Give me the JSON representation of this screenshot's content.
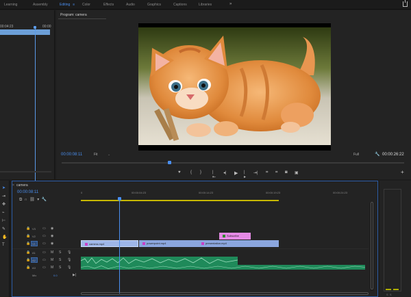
{
  "workspaces": [
    {
      "label": "Learning",
      "active": false
    },
    {
      "label": "Assembly",
      "active": false
    },
    {
      "label": "Editing",
      "active": true
    },
    {
      "label": "Color",
      "active": false
    },
    {
      "label": "Effects",
      "active": false
    },
    {
      "label": "Audio",
      "active": false
    },
    {
      "label": "Graphics",
      "active": false
    },
    {
      "label": "Captions",
      "active": false
    },
    {
      "label": "Libraries",
      "active": false
    }
  ],
  "workspace_menu_glyph": "≡",
  "workspace_more_glyph": "»",
  "source": {
    "timecode_left": "00:04:23",
    "timecode_right": "00:00"
  },
  "program": {
    "tab_label": "Program: camera",
    "tab_menu": "≡",
    "current_timecode": "00:00:08:11",
    "fit": "Fit",
    "resolution": "Full",
    "duration": "00:00:26:22",
    "add_glyph": "+"
  },
  "timeline": {
    "tab_label": "camera",
    "tab_menu": "≡",
    "close_glyph": "×",
    "current_timecode": "00:00:08:11",
    "ruler": [
      "0",
      "00:00:04:23",
      "00:00:14:23",
      "00:00:19:23",
      "00:00:24:23"
    ],
    "video_tracks": [
      {
        "name": "V3"
      },
      {
        "name": "V2"
      },
      {
        "name": "V1"
      }
    ],
    "audio_tracks": [
      {
        "name": "A1"
      },
      {
        "name": "A2"
      },
      {
        "name": "A3"
      }
    ],
    "mix": {
      "name": "Mix",
      "value": "0.0"
    },
    "clips": [
      {
        "label": "camera.mp4",
        "track": "V1"
      },
      {
        "label": "powerpoint.mp4",
        "track": "V1"
      },
      {
        "label": "presentation.mp4",
        "track": "V1"
      },
      {
        "label": "Subscribe",
        "track": "V2"
      }
    ]
  },
  "colors": {
    "accent": "#4a8ff0",
    "video_clip": "#9eb6e8",
    "title_clip": "#e58ae5",
    "audio_clip": "#1f8a5a",
    "work_area": "#c8b800"
  },
  "icons": {
    "selection": "selection-tool-icon",
    "razor": "razor-tool-icon",
    "hand": "hand-tool-icon",
    "type": "type-tool-icon",
    "play": "play-icon",
    "camera": "export-frame-icon",
    "wrench": "settings-wrench-icon",
    "share": "share-icon"
  }
}
